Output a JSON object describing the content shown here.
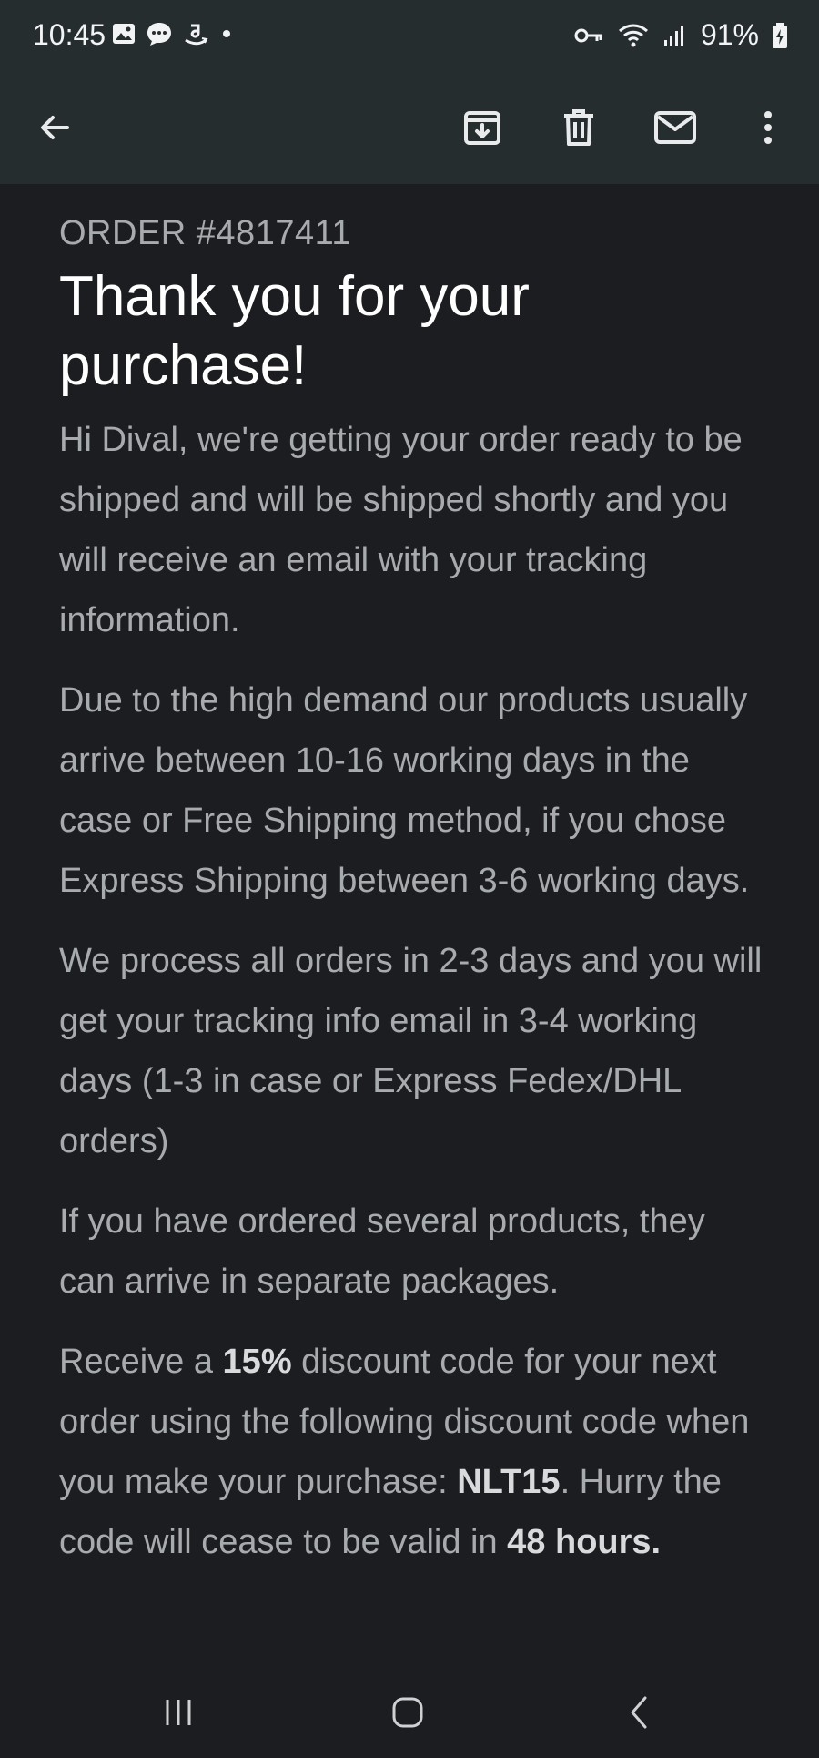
{
  "status_bar": {
    "time": "10:45",
    "battery": "91%",
    "left_icons": [
      "gallery-icon",
      "chat-icon",
      "amazon-icon",
      "dot-icon"
    ],
    "right_icons": [
      "key-icon",
      "wifi-icon",
      "signal-icon",
      "battery-icon"
    ]
  },
  "toolbar": {
    "back": "back-arrow-icon",
    "archive": "archive-icon",
    "delete": "trash-icon",
    "mark_unread": "mail-icon",
    "more": "more-vert-icon"
  },
  "email": {
    "order_label": "ORDER #4817411",
    "title": "Thank you for your purchase!",
    "p1": "Hi Dival, we're getting your order ready to be shipped and will be shipped shortly and you will receive an email with your tracking information.",
    "p2": "Due to the high demand our products usually arrive between 10-16 working days in the case or Free Shipping method, if you chose Express Shipping between 3-6 working days.",
    "p3": "We process all orders in 2-3 days and you will get your tracking info email in 3-4 working days (1-3 in case or Express Fedex/DHL orders)",
    "p4": "If you have ordered several products, they can arrive in separate packages.",
    "p5": {
      "pre": "Receive a ",
      "bold1": "15%",
      "mid": " discount code for your next order using the following discount code when you make your purchase: ",
      "bold2": "NLT15",
      "post": ". Hurry the code will cease to be valid in ",
      "bold3": "48 hours."
    }
  },
  "nav_bar": {
    "recents": "recents-icon",
    "home": "home-icon",
    "back": "back-nav-icon"
  }
}
